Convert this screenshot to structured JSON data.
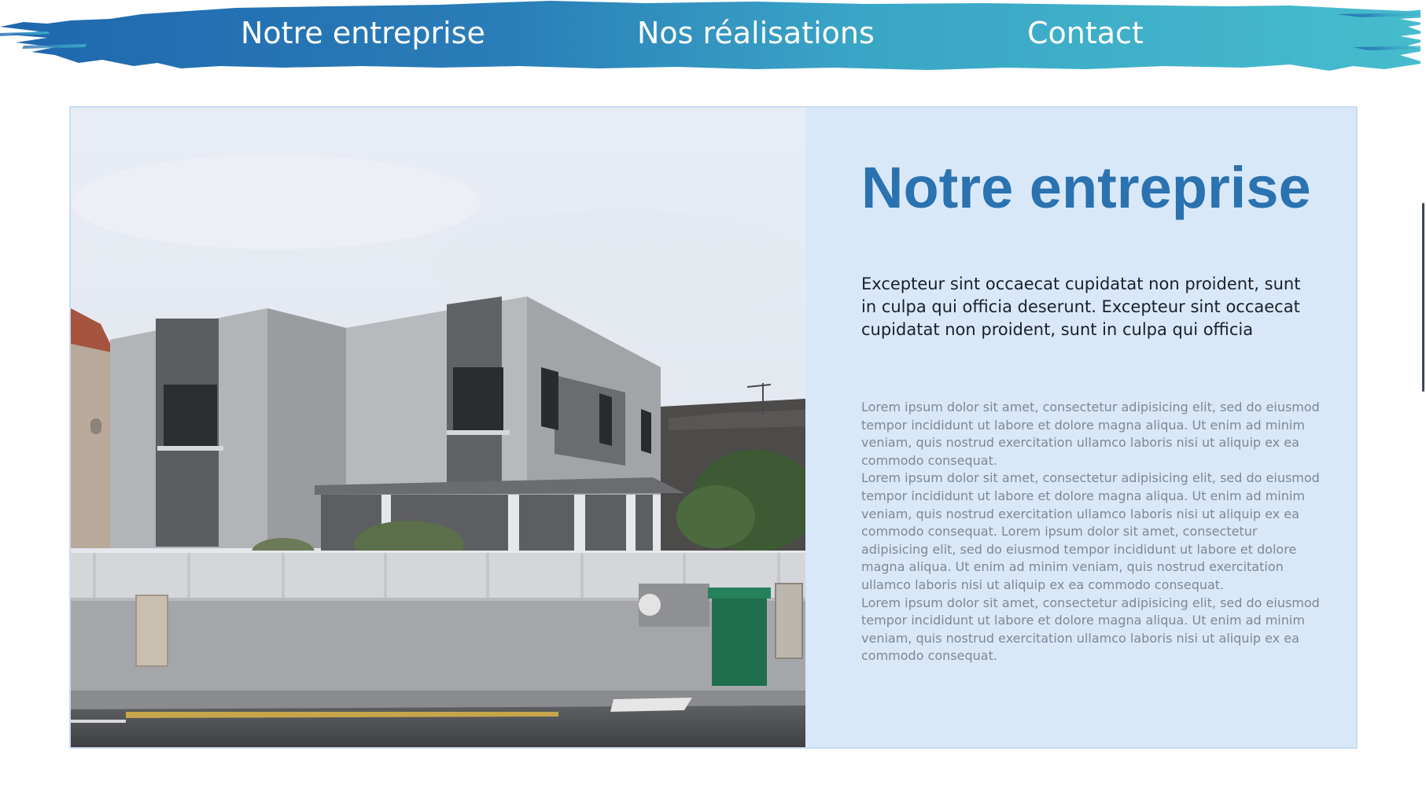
{
  "nav": {
    "items": [
      {
        "label": "Notre entreprise"
      },
      {
        "label": "Nos réalisations"
      },
      {
        "label": "Contact"
      }
    ],
    "gradient_start": "#1f67ae",
    "gradient_end": "#46bccd"
  },
  "about": {
    "title": "Notre entreprise",
    "lead": "Excepteur sint occaecat cupidatat non proident, sunt in culpa qui officia deserunt. Excepteur sint occaecat cupidatat non proident, sunt in culpa qui officia",
    "paragraphs": [
      "Lorem ipsum dolor sit amet, consectetur adipisicing elit, sed do eiusmod tempor incididunt ut labore et dolore magna aliqua. Ut enim ad minim veniam, quis nostrud exercitation ullamco laboris nisi ut aliquip ex ea commodo consequat.",
      "Lorem ipsum dolor sit amet, consectetur adipisicing elit, sed do eiusmod tempor incididunt ut labore et dolore magna aliqua. Ut enim ad minim veniam, quis nostrud exercitation ullamco laboris nisi ut aliquip ex ea commodo consequat. Lorem ipsum dolor sit amet, consectetur adipisicing elit, sed do eiusmod tempor incididunt ut labore et dolore magna aliqua. Ut enim ad minim veniam, quis nostrud exercitation ullamco laboris nisi ut aliquip ex ea commodo consequat.",
      "Lorem ipsum dolor sit amet, consectetur adipisicing elit, sed do eiusmod tempor incididunt ut labore et dolore magna aliqua. Ut enim ad minim veniam, quis nostrud exercitation ullamco laboris nisi ut aliquip ex ea commodo consequat."
    ],
    "panel_color": "#d9e8f8",
    "title_color": "#2a72b0"
  }
}
